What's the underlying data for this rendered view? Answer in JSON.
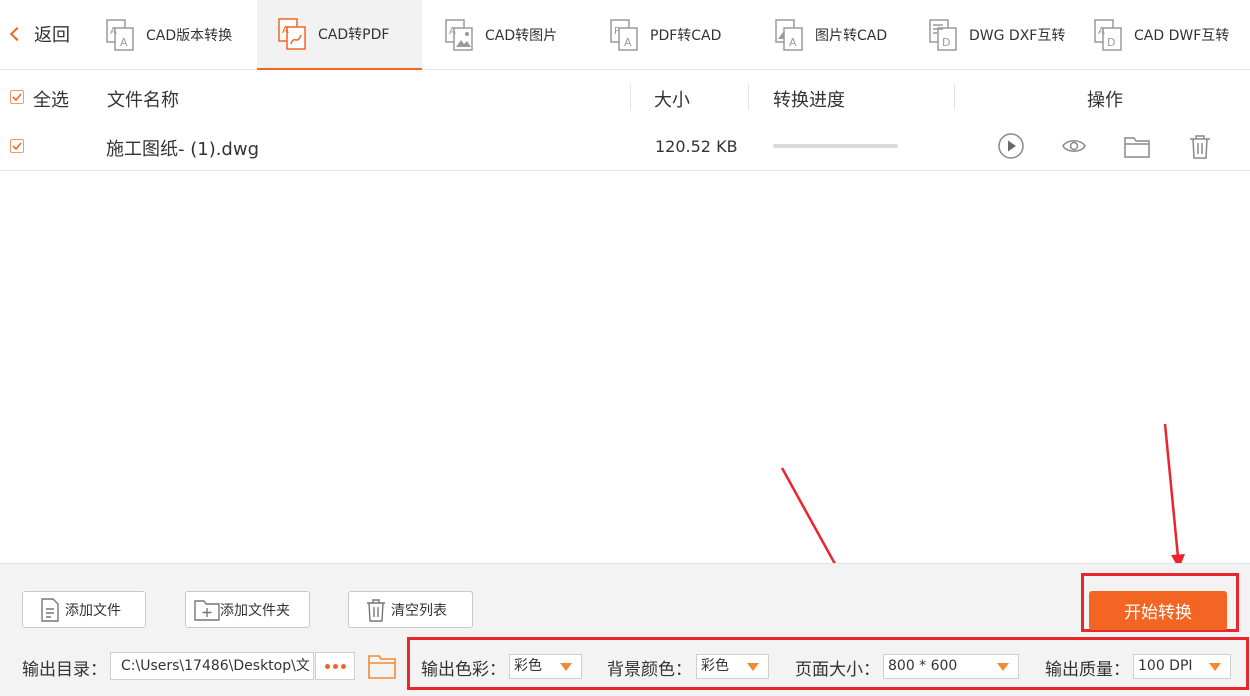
{
  "toolbar": {
    "back_label": "返回",
    "tabs": [
      {
        "label": "CAD版本转换",
        "icon": "cad-version-icon"
      },
      {
        "label": "CAD转PDF",
        "icon": "cad-to-pdf-icon",
        "active": true
      },
      {
        "label": "CAD转图片",
        "icon": "cad-to-image-icon"
      },
      {
        "label": "PDF转CAD",
        "icon": "pdf-to-cad-icon"
      },
      {
        "label": "图片转CAD",
        "icon": "image-to-cad-icon"
      },
      {
        "label": "DWG DXF互转",
        "icon": "dwg-dxf-icon"
      },
      {
        "label": "CAD DWF互转",
        "icon": "cad-dwf-icon"
      }
    ]
  },
  "list": {
    "headers": {
      "select_all": "全选",
      "file_name": "文件名称",
      "size": "大小",
      "progress": "转换进度",
      "actions": "操作"
    },
    "rows": [
      {
        "checked": true,
        "file_name": "施工图纸- (1).dwg",
        "size": "120.52 KB",
        "progress": 0
      }
    ]
  },
  "bottom": {
    "add_file": "添加文件",
    "add_folder": "添加文件夹",
    "clear_list": "清空列表",
    "start_button": "开始转换",
    "output_dir_label": "输出目录：",
    "output_dir_value": "C:\\Users\\17486\\Desktop\\文",
    "color_label": "输出色彩：",
    "color_value": "彩色",
    "bg_label": "背景颜色：",
    "bg_value": "彩色",
    "page_size_label": "页面大小：",
    "page_size_value": "800 * 600",
    "quality_label": "输出质量：",
    "quality_value": "100 DPI"
  },
  "colors": {
    "accent": "#f26522",
    "annotation_red": "#e8262b"
  }
}
